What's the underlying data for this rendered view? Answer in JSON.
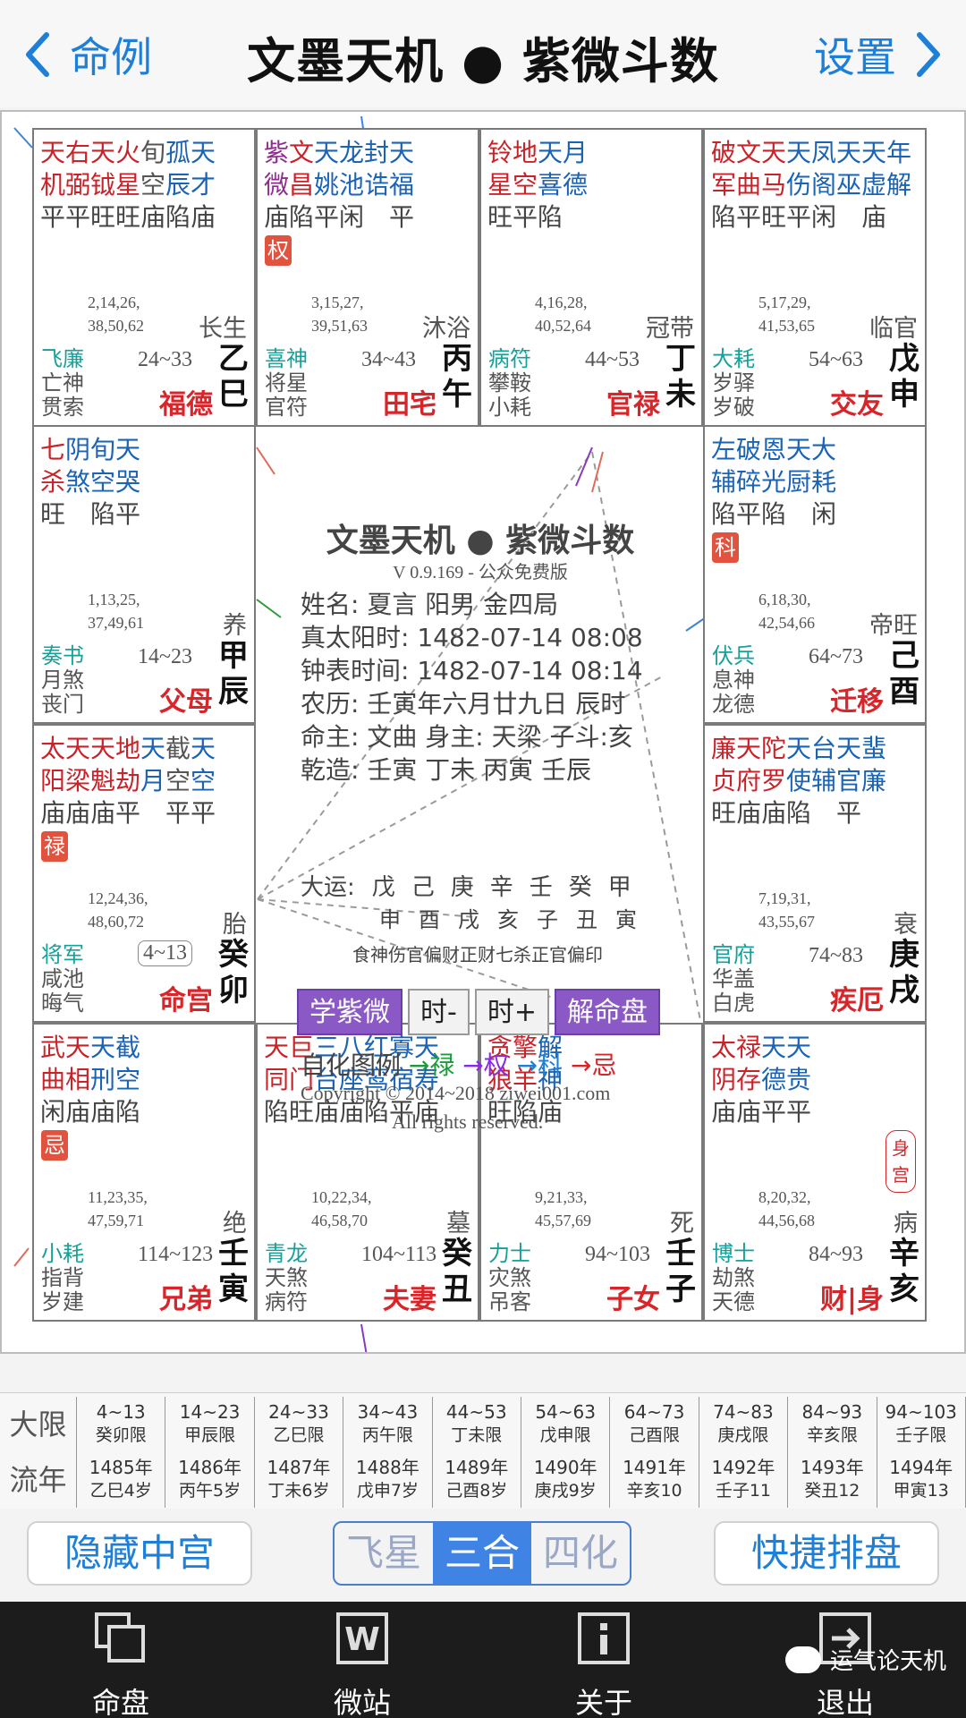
{
  "nav": {
    "back_label": "命例",
    "title": "文墨天机 ● 紫微斗数",
    "settings_label": "设置"
  },
  "palaces": [
    {
      "id": "si",
      "stars_top": [
        [
          "天",
          "#c9232a"
        ],
        [
          "右",
          "#c9232a"
        ],
        [
          "天",
          "#c9232a"
        ],
        [
          "火",
          "#c9232a"
        ],
        [
          "旬",
          "#555"
        ],
        [
          "孤",
          "#1a63b5"
        ],
        [
          "天",
          "#1a63b5"
        ]
      ],
      "stars_mid": [
        [
          "机",
          "#c9232a"
        ],
        [
          "弼",
          "#c9232a"
        ],
        [
          "钺",
          "#c9232a"
        ],
        [
          "星",
          "#c9232a"
        ],
        [
          "空",
          "#555"
        ],
        [
          "辰",
          "#1a63b5"
        ],
        [
          "才",
          "#1a63b5"
        ]
      ],
      "brightness": [
        "平",
        "平",
        "旺",
        "旺",
        "庙",
        "陷",
        "庙"
      ],
      "hua": "",
      "digits1": "2,14,26,",
      "digits2": "38,50,62",
      "stage": "长生",
      "god1": "飞廉",
      "god2": "亡神",
      "god3": "贯索",
      "decade": "24~33",
      "palace": "福德",
      "gan": "乙",
      "zhi": "巳"
    },
    {
      "id": "wu",
      "stars_top": [
        [
          "紫",
          "#8e2d8e"
        ],
        [
          "文",
          "#c9232a"
        ],
        [
          "天",
          "#1a63b5"
        ],
        [
          "龙",
          "#1a63b5"
        ],
        [
          "封",
          "#1a63b5"
        ],
        [
          "天",
          "#1a63b5"
        ]
      ],
      "stars_mid": [
        [
          "微",
          "#8e2d8e"
        ],
        [
          "昌",
          "#c9232a"
        ],
        [
          "姚",
          "#1a63b5"
        ],
        [
          "池",
          "#1a63b5"
        ],
        [
          "诰",
          "#1a63b5"
        ],
        [
          "福",
          "#1a63b5"
        ]
      ],
      "brightness": [
        "庙",
        "陷",
        "平",
        "闲",
        "",
        "平"
      ],
      "hua": "权",
      "digits1": "3,15,27,",
      "digits2": "39,51,63",
      "stage": "沐浴",
      "god1": "喜神",
      "god2": "将星",
      "god3": "官符",
      "decade": "34~43",
      "palace": "田宅",
      "gan": "丙",
      "zhi": "午"
    },
    {
      "id": "wei",
      "stars_top": [
        [
          "铃",
          "#c9232a"
        ],
        [
          "地",
          "#c9232a"
        ],
        [
          "天",
          "#1a63b5"
        ],
        [
          "月",
          "#1a63b5"
        ]
      ],
      "stars_mid": [
        [
          "星",
          "#c9232a"
        ],
        [
          "空",
          "#c9232a"
        ],
        [
          "喜",
          "#1a63b5"
        ],
        [
          "德",
          "#1a63b5"
        ]
      ],
      "brightness": [
        "旺",
        "平",
        "陷",
        ""
      ],
      "hua": "",
      "digits1": "4,16,28,",
      "digits2": "40,52,64",
      "stage": "冠带",
      "god1": "病符",
      "god2": "攀鞍",
      "god3": "小耗",
      "decade": "44~53",
      "palace": "官禄",
      "gan": "丁",
      "zhi": "未"
    },
    {
      "id": "shen",
      "stars_top": [
        [
          "破",
          "#c9232a"
        ],
        [
          "文",
          "#c9232a"
        ],
        [
          "天",
          "#c9232a"
        ],
        [
          "天",
          "#1a63b5"
        ],
        [
          "凤",
          "#1a63b5"
        ],
        [
          "天",
          "#1a63b5"
        ],
        [
          "天",
          "#1a63b5"
        ],
        [
          "年",
          "#1a63b5"
        ]
      ],
      "stars_mid": [
        [
          "军",
          "#c9232a"
        ],
        [
          "曲",
          "#c9232a"
        ],
        [
          "马",
          "#c9232a"
        ],
        [
          "伤",
          "#1a63b5"
        ],
        [
          "阁",
          "#1a63b5"
        ],
        [
          "巫",
          "#1a63b5"
        ],
        [
          "虚",
          "#1a63b5"
        ],
        [
          "解",
          "#1a63b5"
        ]
      ],
      "brightness": [
        "陷",
        "平",
        "旺",
        "平",
        "闲",
        "",
        "庙",
        ""
      ],
      "hua": "",
      "digits1": "5,17,29,",
      "digits2": "41,53,65",
      "stage": "临官",
      "god1": "大耗",
      "god2": "岁驿",
      "god3": "岁破",
      "decade": "54~63",
      "palace": "交友",
      "gan": "戊",
      "zhi": "申"
    },
    {
      "id": "chen",
      "stars_top": [
        [
          "七",
          "#c9232a"
        ],
        [
          "阴",
          "#1a63b5"
        ],
        [
          "旬",
          "#1a63b5"
        ],
        [
          "天",
          "#1a63b5"
        ]
      ],
      "stars_mid": [
        [
          "杀",
          "#c9232a"
        ],
        [
          "煞",
          "#1a63b5"
        ],
        [
          "空",
          "#1a63b5"
        ],
        [
          "哭",
          "#1a63b5"
        ]
      ],
      "brightness": [
        "旺",
        "",
        "陷",
        "平"
      ],
      "hua": "",
      "digits1": "1,13,25,",
      "digits2": "37,49,61",
      "stage": "养",
      "god1": "奏书",
      "god2": "月煞",
      "god3": "丧门",
      "decade": "14~23",
      "palace": "父母",
      "gan": "甲",
      "zhi": "辰"
    },
    {
      "id": "you",
      "stars_top": [
        [
          "左",
          "#1a63b5"
        ],
        [
          "破",
          "#1a63b5"
        ],
        [
          "恩",
          "#1a63b5"
        ],
        [
          "天",
          "#1a63b5"
        ],
        [
          "大",
          "#1a63b5"
        ]
      ],
      "stars_mid": [
        [
          "辅",
          "#1a63b5"
        ],
        [
          "碎",
          "#1a63b5"
        ],
        [
          "光",
          "#1a63b5"
        ],
        [
          "厨",
          "#1a63b5"
        ],
        [
          "耗",
          "#1a63b5"
        ]
      ],
      "brightness": [
        "陷",
        "平",
        "陷",
        "",
        "闲"
      ],
      "hua": "科",
      "digits1": "6,18,30,",
      "digits2": "42,54,66",
      "stage": "帝旺",
      "god1": "伏兵",
      "god2": "息神",
      "god3": "龙德",
      "decade": "64~73",
      "palace": "迁移",
      "gan": "己",
      "zhi": "酉"
    },
    {
      "id": "mao",
      "stars_top": [
        [
          "太",
          "#c9232a"
        ],
        [
          "天",
          "#c9232a"
        ],
        [
          "天",
          "#c9232a"
        ],
        [
          "地",
          "#c9232a"
        ],
        [
          "天",
          "#1a63b5"
        ],
        [
          "截",
          "#555"
        ],
        [
          "天",
          "#1a63b5"
        ]
      ],
      "stars_mid": [
        [
          "阳",
          "#c9232a"
        ],
        [
          "梁",
          "#c9232a"
        ],
        [
          "魁",
          "#c9232a"
        ],
        [
          "劫",
          "#c9232a"
        ],
        [
          "月",
          "#1a63b5"
        ],
        [
          "空",
          "#555"
        ],
        [
          "空",
          "#1a63b5"
        ]
      ],
      "brightness": [
        "庙",
        "庙",
        "庙",
        "平",
        "",
        "平",
        "平"
      ],
      "hua": "禄",
      "digits1": "12,24,36,",
      "digits2": "48,60,72",
      "stage": "胎",
      "god1": "将军",
      "god2": "咸池",
      "god3": "晦气",
      "decade": "4~13",
      "palace": "命宫",
      "gan": "癸",
      "zhi": "卯"
    },
    {
      "id": "xu",
      "stars_top": [
        [
          "廉",
          "#c9232a"
        ],
        [
          "天",
          "#c9232a"
        ],
        [
          "陀",
          "#c9232a"
        ],
        [
          "天",
          "#1a63b5"
        ],
        [
          "台",
          "#1a63b5"
        ],
        [
          "天",
          "#1a63b5"
        ],
        [
          "蜚",
          "#1a63b5"
        ]
      ],
      "stars_mid": [
        [
          "贞",
          "#c9232a"
        ],
        [
          "府",
          "#c9232a"
        ],
        [
          "罗",
          "#c9232a"
        ],
        [
          "使",
          "#1a63b5"
        ],
        [
          "辅",
          "#1a63b5"
        ],
        [
          "官",
          "#1a63b5"
        ],
        [
          "廉",
          "#1a63b5"
        ]
      ],
      "brightness": [
        "旺",
        "庙",
        "庙",
        "陷",
        "",
        "平",
        ""
      ],
      "hua": "",
      "digits1": "7,19,31,",
      "digits2": "43,55,67",
      "stage": "衰",
      "god1": "官府",
      "god2": "华盖",
      "god3": "白虎",
      "decade": "74~83",
      "palace": "疾厄",
      "gan": "庚",
      "zhi": "戌"
    },
    {
      "id": "yin",
      "stars_top": [
        [
          "武",
          "#c9232a"
        ],
        [
          "天",
          "#c9232a"
        ],
        [
          "天",
          "#1a63b5"
        ],
        [
          "截",
          "#1a63b5"
        ]
      ],
      "stars_mid": [
        [
          "曲",
          "#c9232a"
        ],
        [
          "相",
          "#c9232a"
        ],
        [
          "刑",
          "#1a63b5"
        ],
        [
          "空",
          "#1a63b5"
        ]
      ],
      "brightness": [
        "闲",
        "庙",
        "庙",
        "陷"
      ],
      "hua": "忌",
      "digits1": "11,23,35,",
      "digits2": "47,59,71",
      "stage": "绝",
      "god1": "小耗",
      "god2": "指背",
      "god3": "岁建",
      "decade": "114~123",
      "palace": "兄弟",
      "gan": "壬",
      "zhi": "寅"
    },
    {
      "id": "chou",
      "stars_top": [
        [
          "天",
          "#c9232a"
        ],
        [
          "巨",
          "#c9232a"
        ],
        [
          "三",
          "#1a63b5"
        ],
        [
          "八",
          "#1a63b5"
        ],
        [
          "红",
          "#1a63b5"
        ],
        [
          "寡",
          "#1a63b5"
        ],
        [
          "天",
          "#1a63b5"
        ]
      ],
      "stars_mid": [
        [
          "同",
          "#c9232a"
        ],
        [
          "门",
          "#c9232a"
        ],
        [
          "台",
          "#1a63b5"
        ],
        [
          "座",
          "#1a63b5"
        ],
        [
          "鸾",
          "#1a63b5"
        ],
        [
          "宿",
          "#1a63b5"
        ],
        [
          "寿",
          "#1a63b5"
        ]
      ],
      "brightness": [
        "陷",
        "旺",
        "庙",
        "庙",
        "陷",
        "平",
        "庙"
      ],
      "hua": "",
      "digits1": "10,22,34,",
      "digits2": "46,58,70",
      "stage": "墓",
      "god1": "青龙",
      "god2": "天煞",
      "god3": "病符",
      "decade": "104~113",
      "palace": "夫妻",
      "gan": "癸",
      "zhi": "丑"
    },
    {
      "id": "zi",
      "stars_top": [
        [
          "贪",
          "#c9232a"
        ],
        [
          "擎",
          "#c9232a"
        ],
        [
          "解",
          "#1a63b5"
        ]
      ],
      "stars_mid": [
        [
          "狼",
          "#c9232a"
        ],
        [
          "羊",
          "#c9232a"
        ],
        [
          "神",
          "#1a63b5"
        ]
      ],
      "brightness": [
        "旺",
        "陷",
        "庙"
      ],
      "hua": "",
      "digits1": "9,21,33,",
      "digits2": "45,57,69",
      "stage": "死",
      "god1": "力士",
      "god2": "灾煞",
      "god3": "吊客",
      "decade": "94~103",
      "palace": "子女",
      "gan": "壬",
      "zhi": "子"
    },
    {
      "id": "hai",
      "stars_top": [
        [
          "太",
          "#c9232a"
        ],
        [
          "禄",
          "#c9232a"
        ],
        [
          "天",
          "#1a63b5"
        ],
        [
          "天",
          "#1a63b5"
        ]
      ],
      "stars_mid": [
        [
          "阴",
          "#c9232a"
        ],
        [
          "存",
          "#c9232a"
        ],
        [
          "德",
          "#1a63b5"
        ],
        [
          "贵",
          "#1a63b5"
        ]
      ],
      "brightness": [
        "庙",
        "庙",
        "平",
        "平"
      ],
      "hua": "",
      "digits1": "8,20,32,",
      "digits2": "44,56,68",
      "stage": "病",
      "god1": "博士",
      "god2": "劫煞",
      "god3": "天德",
      "decade": "84~93",
      "palace": "财|身",
      "gan": "辛",
      "zhi": "亥",
      "seal": "身宫"
    }
  ],
  "center": {
    "title": "文墨天机 ● 紫微斗数",
    "version": "V 0.9.169 - 公众免费版",
    "lines": [
      "姓名: 夏言          阳男 金四局",
      "真太阳时: 1482-07-14   08:08",
      "钟表时间: 1482-07-14   08:14",
      "农历: 壬寅年六月廿九日 辰时",
      "命主: 文曲 身主: 天梁 子斗:亥",
      "乾造: 壬寅   丁未   丙寅   壬辰"
    ],
    "dayun_label": "大运:",
    "dayun_gan": [
      "戊",
      "己",
      "庚",
      "辛",
      "壬",
      "癸",
      "甲"
    ],
    "dayun_zhi": [
      "申",
      "酉",
      "戌",
      "亥",
      "子",
      "丑",
      "寅"
    ],
    "gods": "食神伤官偏财正财七杀正官偏印",
    "buttons": [
      "学紫微",
      "时-",
      "时+",
      "解命盘"
    ],
    "legend_label": "自化图例",
    "legend": [
      "→禄",
      "→权",
      "→科",
      "→忌"
    ],
    "copyright": "Copyright © 2014~2018 ziwei001.com",
    "rights": "All rights reserved."
  },
  "table": {
    "row1_label": "大限",
    "row2_label": "流年",
    "daxian": [
      [
        "4~13",
        "癸卯限"
      ],
      [
        "14~23",
        "甲辰限"
      ],
      [
        "24~33",
        "乙巳限"
      ],
      [
        "34~43",
        "丙午限"
      ],
      [
        "44~53",
        "丁未限"
      ],
      [
        "54~63",
        "戊申限"
      ],
      [
        "64~73",
        "己酉限"
      ],
      [
        "74~83",
        "庚戌限"
      ],
      [
        "84~93",
        "辛亥限"
      ],
      [
        "94~103",
        "壬子限"
      ]
    ],
    "liunian": [
      [
        "1485年",
        "乙巳4岁"
      ],
      [
        "1486年",
        "丙午5岁"
      ],
      [
        "1487年",
        "丁未6岁"
      ],
      [
        "1488年",
        "戊申7岁"
      ],
      [
        "1489年",
        "己酉8岁"
      ],
      [
        "1490年",
        "庚戌9岁"
      ],
      [
        "1491年",
        "辛亥10"
      ],
      [
        "1492年",
        "壬子11"
      ],
      [
        "1493年",
        "癸丑12"
      ],
      [
        "1494年",
        "甲寅13"
      ]
    ]
  },
  "controls": {
    "hide_center": "隐藏中宫",
    "seg": [
      "飞星",
      "三合",
      "四化"
    ],
    "seg_active": 1,
    "quick": "快捷排盘"
  },
  "tabs": [
    {
      "label": "命盘",
      "icon": "chart-icon"
    },
    {
      "label": "微站",
      "icon": "w-icon"
    },
    {
      "label": "关于",
      "icon": "info-icon"
    },
    {
      "label": "退出",
      "icon": "exit-icon"
    }
  ],
  "watermark": "运气论天机",
  "colors": {
    "accent": "#1e7fd8",
    "red": "#d8252a",
    "purple": "#8a59c6",
    "seg_active": "#3f84e5"
  }
}
